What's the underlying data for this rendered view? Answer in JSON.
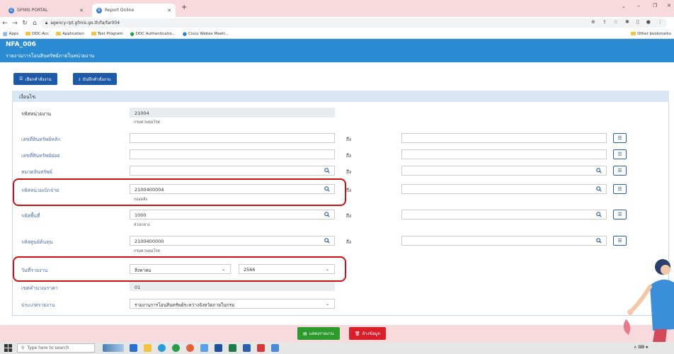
{
  "browser": {
    "tabs": [
      {
        "label": "GFMIS PORTAL",
        "active": false
      },
      {
        "label": "Report Online",
        "active": true
      }
    ],
    "new_tab_symbol": "+",
    "url": "agency-rpt.gfmis.go.th/fa/far004",
    "bookmarks": [
      "Apps",
      "DDC-Acc",
      "Application",
      "Test Program",
      "DDC Authenticatio...",
      "Cisco Webex Meeti..."
    ],
    "other_bookmarks": "Other bookmarks"
  },
  "header": {
    "code": "NFA_006",
    "title": "รายงานการโอนสินทรัพย์ภายในหน่วยงาน"
  },
  "actions": {
    "select_label": "เลือกคำสั่งงาน",
    "save_label": "บันทึกคำสั่งงาน"
  },
  "panel": {
    "title": "เงื่อนไข"
  },
  "form": {
    "agency_code": {
      "label": "รหัสหน่วยงาน",
      "value": "21004",
      "sub": "กรมควบคุมโรค"
    },
    "main_asset": {
      "label": "เลขที่สินทรัพย์หลัก",
      "to": "ถึง"
    },
    "sub_asset": {
      "label": "เลขที่สินทรัพย์ย่อย",
      "to": "ถึง"
    },
    "asset_class": {
      "label": "หมวดสินทรัพย์",
      "to": "ถึง"
    },
    "disbursing_unit": {
      "label": "รหัสหน่วยเบิกจ่าย",
      "value": "2100400004",
      "sub": "กองคลัง",
      "to": "ถึง"
    },
    "area_code": {
      "label": "รหัสพื้นที่",
      "value": "1000",
      "sub": "ส่วนกลาง",
      "to": "ถึง"
    },
    "cost_center": {
      "label": "รหัสศูนย์ต้นทุน",
      "value": "2100400000",
      "sub": "กรมควบคุมโรค",
      "to": "ถึง"
    },
    "report_date": {
      "label": "วันที่รายงาน",
      "month": "สิงหาคม",
      "year": "2566"
    },
    "depreciation": {
      "label": "เขตคำนวณราคา",
      "value": "01"
    },
    "report_type": {
      "label": "ประเภทรายงาน",
      "value": "รายงานการโอนสินทรัพย์ระหว่างจังหวัดภายในกรม"
    }
  },
  "buttons": {
    "show_report": "แสดงรายงาน",
    "clear_data": "ล้างข้อมูล"
  },
  "taskbar": {
    "search_placeholder": "Type here to search"
  },
  "colors": {
    "header": "#2a8bd3",
    "highlight": "#d01010",
    "show_button": "#2d9a2d",
    "clear_button": "#d91e2a"
  }
}
